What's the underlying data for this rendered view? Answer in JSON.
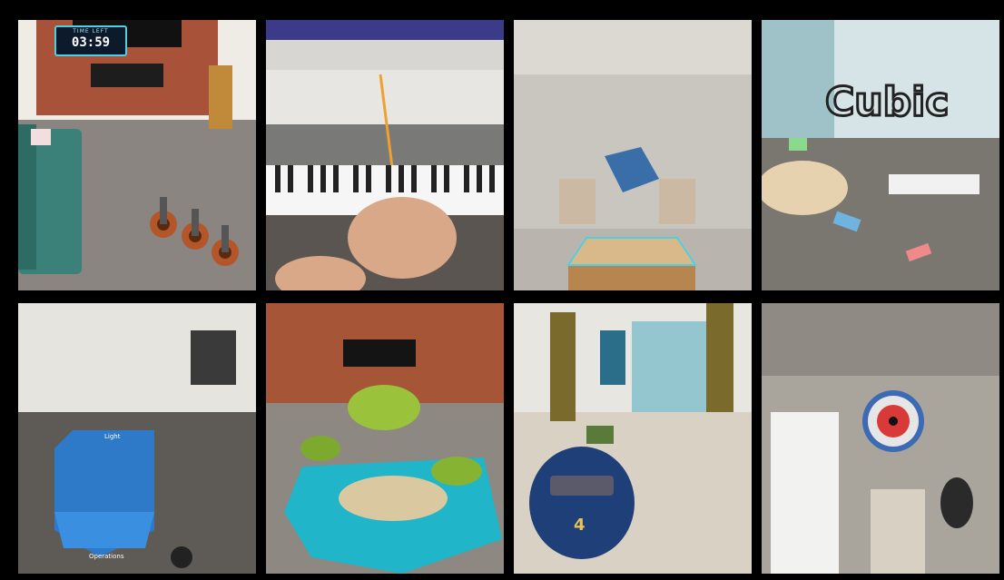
{
  "tiles": [
    {
      "scene": "living-room-target-practice",
      "timer": {
        "label": "TIME LEFT",
        "value": "03:59"
      }
    },
    {
      "scene": "virtual-piano-lesson"
    },
    {
      "scene": "hologram-board-game"
    },
    {
      "scene": "block-letter-sculpting",
      "word": "Cubic"
    },
    {
      "scene": "3d-painting-tool-palette",
      "palette_header": "Light",
      "palette_section": "Operations"
    },
    {
      "scene": "tabletop-island-diorama"
    },
    {
      "scene": "shooting-gallery",
      "ammo_count": "4"
    },
    {
      "scene": "dartboard-throw"
    }
  ],
  "colors": {
    "background": "#000000",
    "accent": "#4dd0e1",
    "timer_bg": "#0d1a2b"
  }
}
